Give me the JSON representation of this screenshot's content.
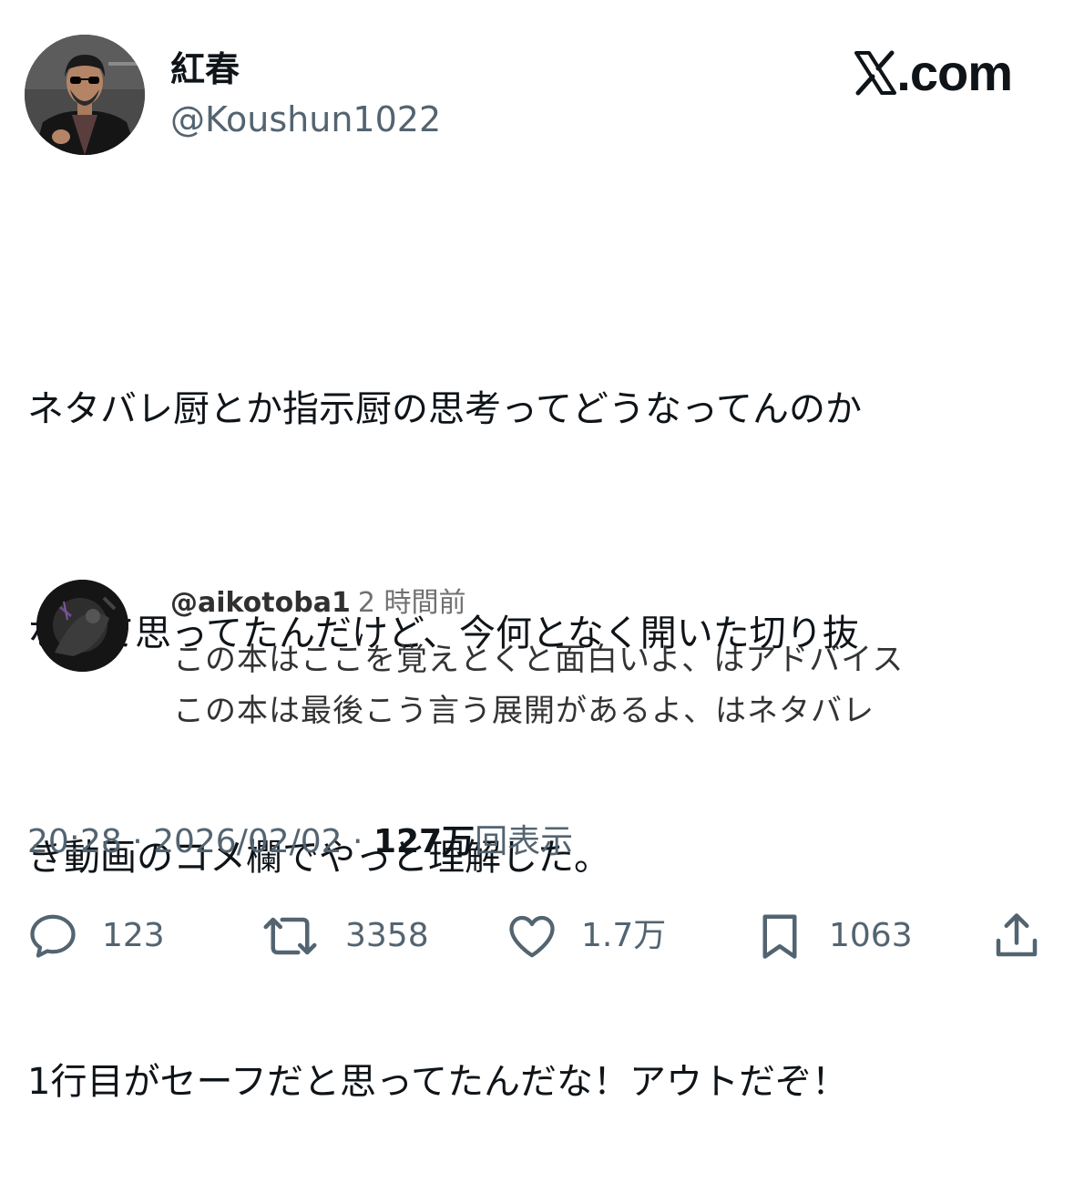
{
  "author": {
    "display_name": "紅春",
    "handle": "@Koushun1022",
    "avatar": "profile-photo"
  },
  "brand": {
    "text": ".com",
    "icon": "x-logo-icon"
  },
  "tweet": {
    "lines": [
      "ネタバレ厨とか指示厨の思考ってどうなってんのか",
      "なって思ってたんだけど、今何となく開いた切り抜",
      "き動画のコメ欄でやっと理解した。",
      "1行目がセーフだと思ってたんだな！アウトだぞ！"
    ]
  },
  "embedded_comment": {
    "username": "@aikotoba1",
    "time": "2 時間前",
    "lines": [
      "この本はここを覚えとくと面白いよ、はアドバイス",
      "この本は最後こう言う展開があるよ、はネタバレ"
    ]
  },
  "meta": {
    "time": "20:28",
    "separator": " · ",
    "date": "2026/02/02",
    "views_count": "127万",
    "views_label": "回表示"
  },
  "actions": {
    "reply": {
      "count": "123",
      "icon": "reply-icon"
    },
    "retweet": {
      "count": "3358",
      "icon": "retweet-icon"
    },
    "like": {
      "count": "1.7万",
      "icon": "heart-icon"
    },
    "bookmark": {
      "count": "1063",
      "icon": "bookmark-icon"
    },
    "share": {
      "icon": "share-icon"
    }
  },
  "colors": {
    "text_primary": "#0f1419",
    "text_secondary": "#536471",
    "background": "#ffffff"
  }
}
